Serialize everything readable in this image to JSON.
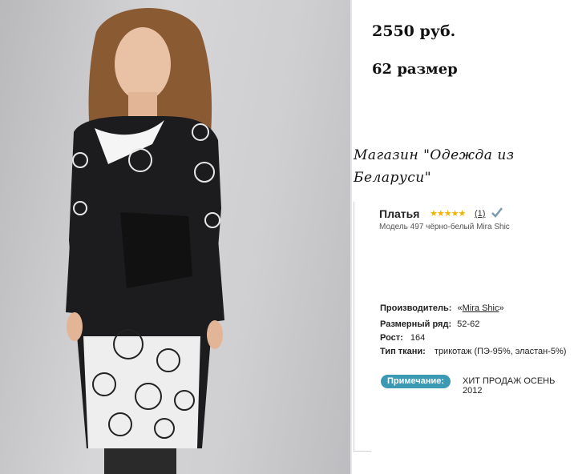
{
  "price": "2550 руб.",
  "size": "62 размер",
  "shop_line1": "Магазин \"Одежда из",
  "shop_line2": "Беларуси\"",
  "product": {
    "category": "Платья",
    "stars": "★★★★★",
    "rating_count": "(1)",
    "model": "Модель 497 чёрно-белый Mira Shic"
  },
  "specs": {
    "maker_label": "Производитель:",
    "maker_prefix": "«",
    "maker_value": "Mira Shic",
    "maker_suffix": "»",
    "size_range_label": "Размерный ряд:",
    "size_range_value": "52-62",
    "height_label": "Рост:",
    "height_value": "164",
    "fabric_label": "Тип ткани:",
    "fabric_value": "трикотаж (ПЭ-95%, эластан-5%)"
  },
  "note": {
    "label": "Примечание:",
    "text": "ХИТ ПРОДАЖ ОСЕНЬ 2012"
  },
  "colors": {
    "badge": "#3a9ab4",
    "stars": "#f0b400"
  }
}
